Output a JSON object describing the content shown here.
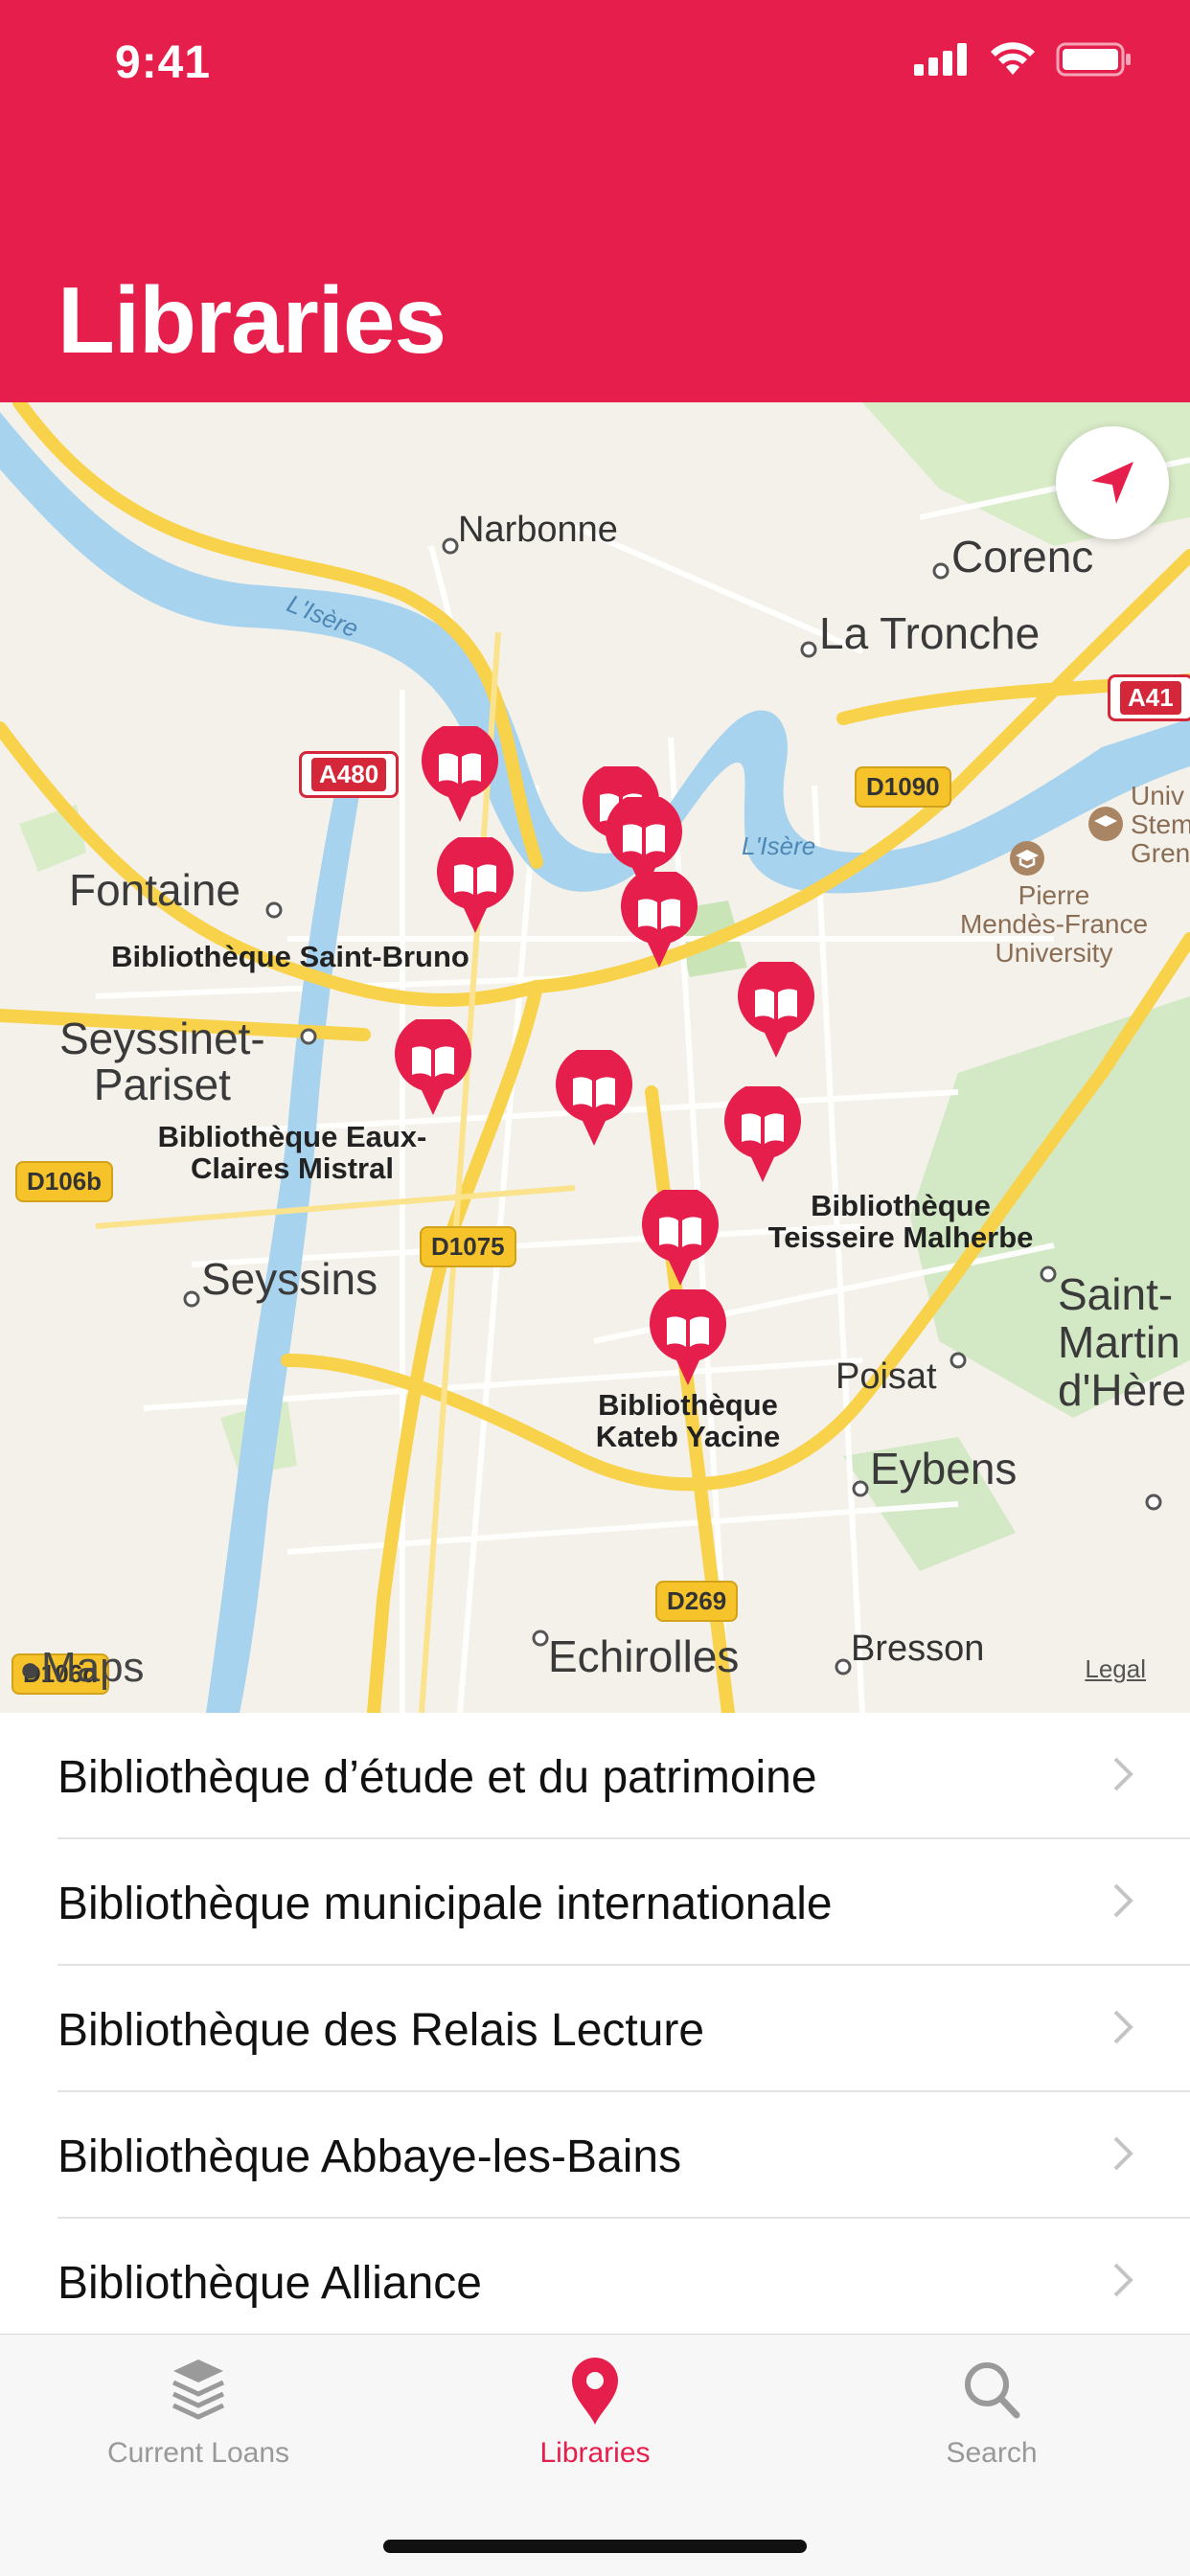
{
  "status_bar": {
    "time": "9:41"
  },
  "header": {
    "title": "Libraries"
  },
  "map": {
    "places": {
      "narbonne": "Narbonne",
      "corenc": "Corenc",
      "la_tronche": "La Tronche",
      "fontaine": "Fontaine",
      "seyssinet": "Seyssinet-\nPariset",
      "seyssins": "Seyssins",
      "poisat": "Poisat",
      "eybens": "Eybens",
      "echirolles": "Echirolles",
      "bresson": "Bresson",
      "saint_martin": "Saint-\nMartin\nd'Hère"
    },
    "water_labels": {
      "isere_1": "L'Isère",
      "isere_2": "L'Isère"
    },
    "university": "Pierre\nMendès-France\nUniversity",
    "univ_edge": "Univ\nStem\nGren",
    "road_shields": {
      "a480": "A480",
      "a41": "A41",
      "d1090": "D1090",
      "d106b": "D106b",
      "d1075": "D1075",
      "d269": "D269",
      "d106d": "D106d"
    },
    "library_labels": {
      "saint_bruno": "Bibliothèque Saint-Bruno",
      "eaux_claires": "Bibliothèque Eaux-\nClaires Mistral",
      "teisseire": "Bibliothèque\nTeisseire Malherbe",
      "kateb": "Bibliothèque\nKateb Yacine"
    },
    "maps_logo": "Maps",
    "legal": "Legal"
  },
  "libraries": [
    {
      "name": "Bibliothèque d’étude et du patrimoine"
    },
    {
      "name": "Bibliothèque municipale internationale"
    },
    {
      "name": "Bibliothèque des Relais Lecture"
    },
    {
      "name": "Bibliothèque Abbaye-les-Bains"
    },
    {
      "name": "Bibliothèque Alliance"
    }
  ],
  "tab_bar": {
    "tabs": [
      {
        "label": "Current Loans",
        "icon": "stack-icon",
        "active": false
      },
      {
        "label": "Libraries",
        "icon": "map-pin-icon",
        "active": true
      },
      {
        "label": "Search",
        "icon": "search-icon",
        "active": false
      }
    ]
  },
  "colors": {
    "accent": "#e61e4b",
    "map_bg": "#f4f1ea",
    "water": "#a7d3ee",
    "highway": "#f8d24a"
  }
}
